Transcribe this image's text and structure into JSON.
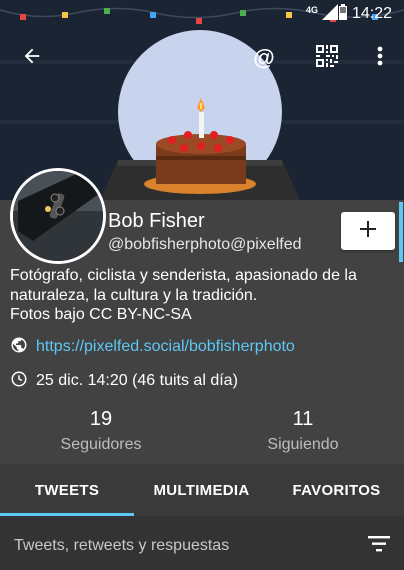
{
  "status": {
    "network": "4G",
    "time": "14:22"
  },
  "toolbar": {
    "mention_label": "@"
  },
  "profile": {
    "display_name": "Bob Fisher",
    "username": "@bobfisherphoto@pixelfed",
    "bio_lines": [
      "Fotógrafo, ciclista y senderista, apasionado de la",
      "naturaleza, la cultura y la tradición.",
      "Fotos bajo CC BY-NC-SA"
    ],
    "link": "https://pixelfed.social/bobfisherphoto",
    "joined": "25 dic. 14:20 (46 tuits al día)"
  },
  "stats": {
    "followers_count": "19",
    "followers_label": "Seguidores",
    "following_count": "11",
    "following_label": "Siguiendo"
  },
  "tabs": [
    {
      "label": "TWEETS"
    },
    {
      "label": "MULTIMEDIA"
    },
    {
      "label": "FAVORITOS"
    }
  ],
  "filter": {
    "label": "Tweets, retweets y respuestas"
  },
  "colors": {
    "accent": "#5dc8f5",
    "background": "#424242",
    "banner": "#1b2433"
  },
  "icons": {
    "back": "arrow-left-icon",
    "mention": "at-icon",
    "qr": "qr-code-icon",
    "more": "more-vert-icon",
    "follow": "plus-icon",
    "link": "globe-icon",
    "date": "clock-icon",
    "filter": "filter-icon"
  }
}
